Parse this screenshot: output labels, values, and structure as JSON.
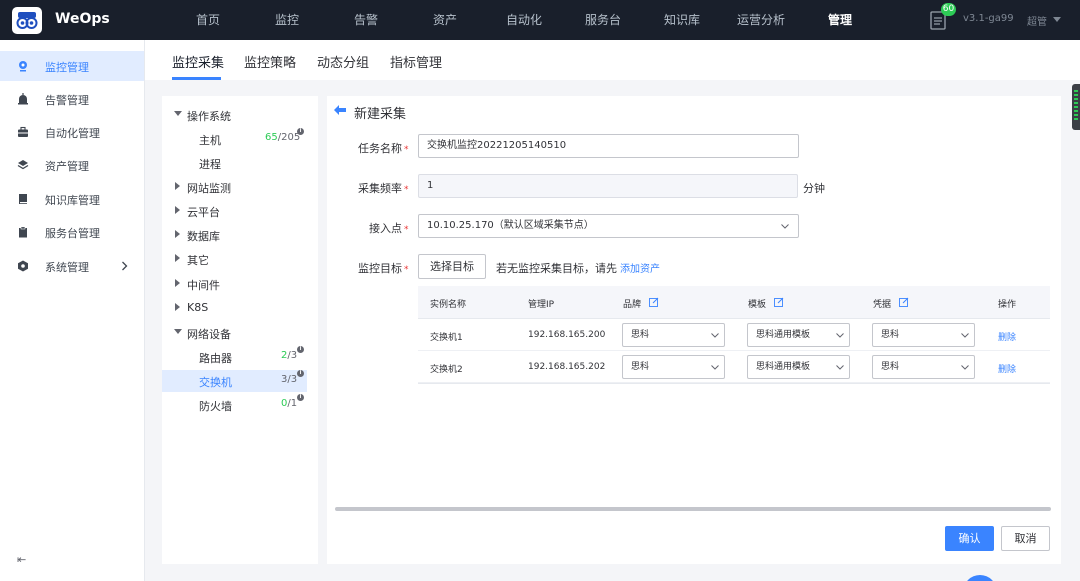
{
  "app": {
    "brand": "WeOps",
    "version": "v3.1-ga99",
    "user": "超管",
    "notice_count": "60"
  },
  "nav": [
    "首页",
    "监控",
    "告警",
    "资产",
    "自动化",
    "服务台",
    "知识库",
    "运营分析",
    "管理"
  ],
  "sidebar": {
    "items": [
      {
        "label": "监控管理",
        "icon": "monitor-pin-icon"
      },
      {
        "label": "告警管理",
        "icon": "alarm-icon"
      },
      {
        "label": "自动化管理",
        "icon": "briefcase-icon"
      },
      {
        "label": "资产管理",
        "icon": "layers-icon"
      },
      {
        "label": "知识库管理",
        "icon": "book-icon"
      },
      {
        "label": "服务台管理",
        "icon": "clipboard-icon"
      },
      {
        "label": "系统管理",
        "icon": "hexagon-gear-icon"
      }
    ],
    "collapse_glyph": "⇤"
  },
  "tabs": [
    "监控采集",
    "监控策略",
    "动态分组",
    "指标管理"
  ],
  "tree": {
    "items": [
      {
        "label": "操作系统",
        "caret": "down"
      },
      {
        "label": "主机",
        "child": true,
        "count_a": "65",
        "count_b": "/205"
      },
      {
        "label": "进程",
        "child": true
      },
      {
        "label": "网站监测",
        "caret": "right"
      },
      {
        "label": "云平台",
        "caret": "right"
      },
      {
        "label": "数据库",
        "caret": "right"
      },
      {
        "label": "其它",
        "caret": "right"
      },
      {
        "label": "中间件",
        "caret": "right"
      },
      {
        "label": "K8S",
        "caret": "right"
      },
      {
        "label": "网络设备",
        "caret": "down"
      },
      {
        "label": "路由器",
        "child": true,
        "count_a": "2",
        "count_b": "/3"
      },
      {
        "label": "交换机",
        "child": true,
        "count_a": "3",
        "count_b": "/3",
        "selected": true
      },
      {
        "label": "防火墙",
        "child": true,
        "count_a": "0",
        "count_b": "/1"
      }
    ]
  },
  "form": {
    "title": "新建采集",
    "task_name_label": "任务名称",
    "task_name_value": "交换机监控20221205140510",
    "freq_label": "采集频率",
    "freq_value": "1",
    "freq_unit": "分钟",
    "access_label": "接入点",
    "access_value": "10.10.25.170（默认区域采集节点）",
    "target_label": "监控目标",
    "select_target_btn": "选择目标",
    "target_hint": "若无监控采集目标，请先",
    "add_asset_link": "添加资产"
  },
  "table": {
    "headers": [
      "实例名称",
      "管理IP",
      "品牌",
      "模板",
      "凭据",
      "操作"
    ],
    "rows": [
      {
        "name": "交换机1",
        "ip": "192.168.165.200",
        "brand": "思科",
        "template": "思科通用模板",
        "credential": "思科",
        "action": "删除"
      },
      {
        "name": "交换机2",
        "ip": "192.168.165.202",
        "brand": "思科",
        "template": "思科通用模板",
        "credential": "思科",
        "action": "删除"
      }
    ]
  },
  "footer": {
    "confirm": "确认",
    "cancel": "取消"
  },
  "colors": {
    "primary": "#3a84ff",
    "topbar": "#191f2b",
    "success": "#2dcb56",
    "danger": "#ea3636"
  }
}
